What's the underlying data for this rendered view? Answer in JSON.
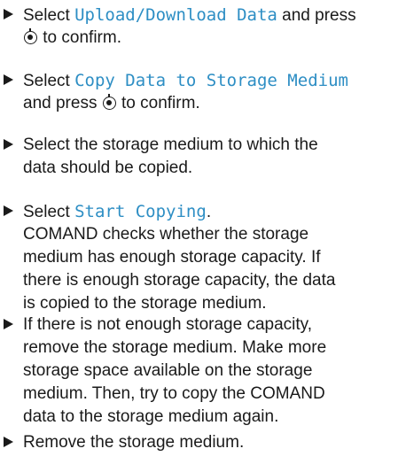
{
  "steps": [
    {
      "select_prefix": "Select ",
      "menu_item": "Upload/Download Data",
      "tail_1": " and press",
      "confirm_icon": "rotary-knob-icon",
      "confirm_text": " to confirm."
    },
    {
      "select_prefix": "Select ",
      "menu_item": "Copy Data to Storage Medium",
      "press_text": "and press ",
      "confirm_icon": "rotary-knob-icon",
      "confirm_text": " to confirm."
    },
    {
      "line_1": "Select the storage medium to which the",
      "line_2": "data should be copied."
    },
    {
      "select_prefix": "Select ",
      "menu_item": "Start Copying",
      "period": ".",
      "line_2": "COMAND checks whether the storage",
      "line_3": "medium has enough storage capacity. If",
      "line_4": "there is enough storage capacity, the data",
      "line_5": "is copied to the storage medium."
    },
    {
      "line_1": "If there is not enough storage capacity,",
      "line_2": "remove the storage medium. Make more",
      "line_3": "storage space available on the storage",
      "line_4": "medium. Then, try to copy the COMAND",
      "line_5": "data to the storage medium again."
    },
    {
      "line_1": "Remove the storage medium."
    }
  ],
  "colors": {
    "text": "#1a1a1a",
    "ui_highlight": "#2d8ec4"
  }
}
